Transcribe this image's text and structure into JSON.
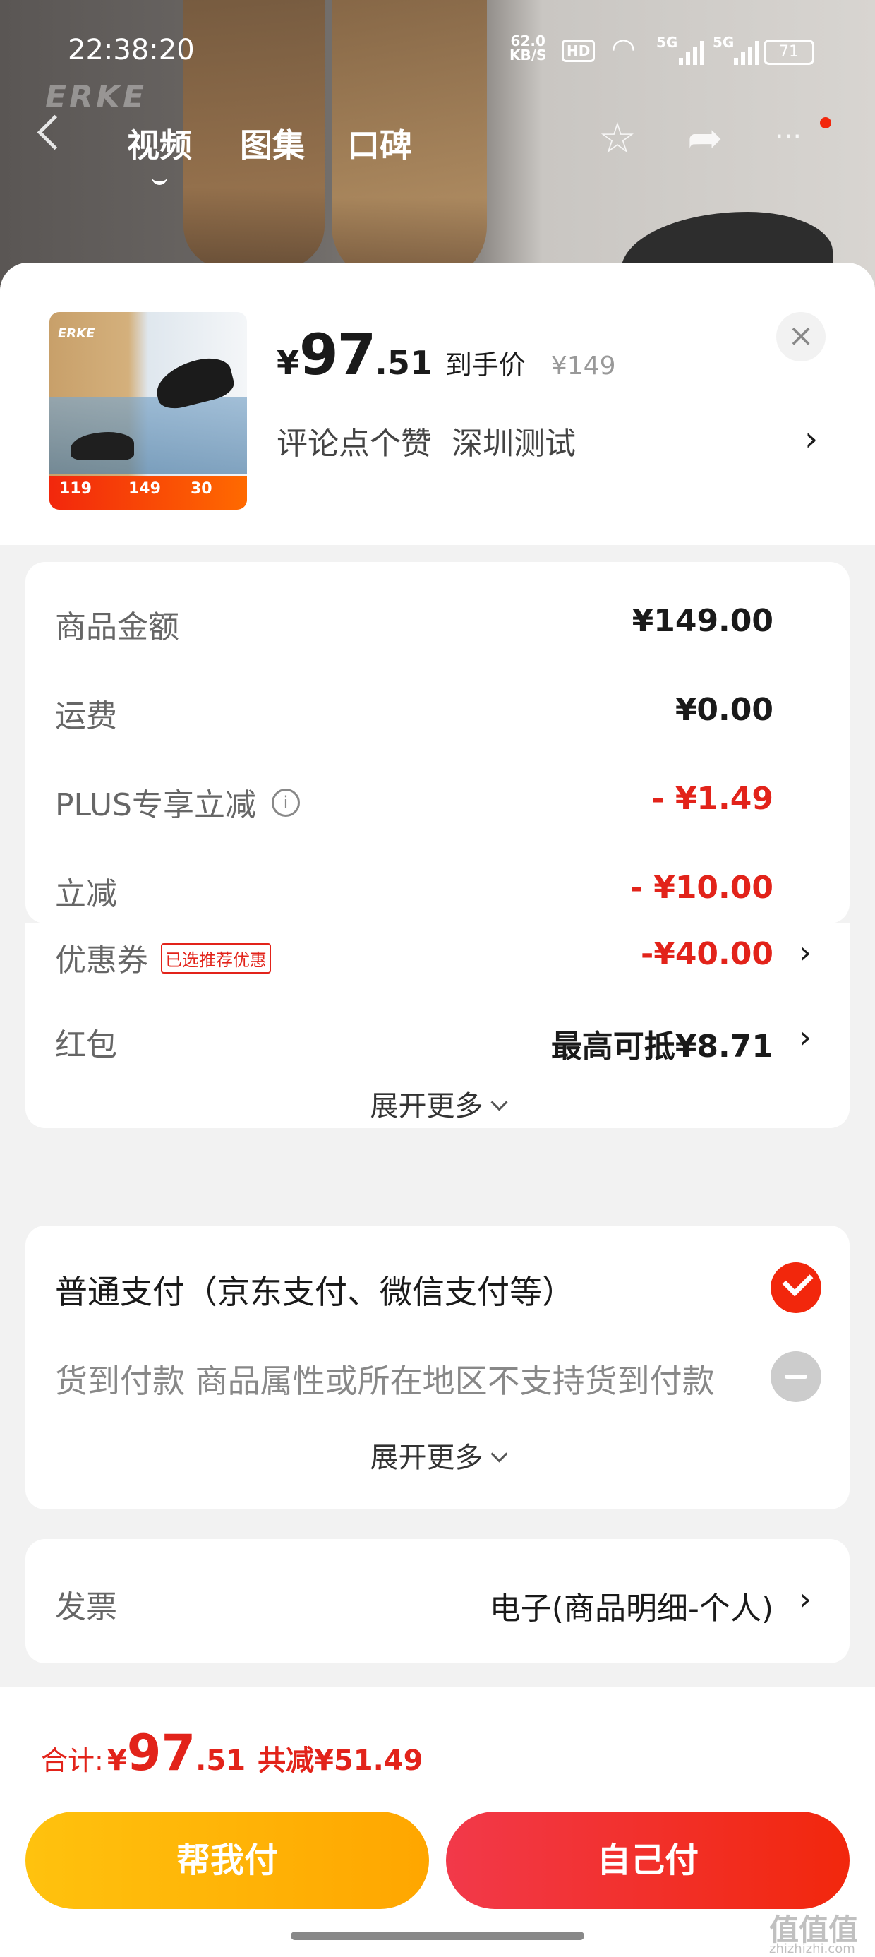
{
  "status_bar": {
    "time": "22:38:20",
    "net_speed": "62.0",
    "net_unit": "KB/S",
    "hd": "HD",
    "sig1": "5G",
    "sig2": "5G",
    "battery": "71"
  },
  "top_nav": {
    "tabs": [
      "视频",
      "图集",
      "口碑"
    ],
    "active_tab": 0,
    "watermark_logo": "ERKE"
  },
  "product": {
    "thumb_logo": "ERKE",
    "thumb_banner": [
      "119",
      "149",
      "30"
    ],
    "price_currency": "¥",
    "price_int": "97",
    "price_dec": ".51",
    "price_label": "到手价",
    "original_price": "¥149",
    "sub_items": [
      "评论点个赞",
      "深圳测试"
    ],
    "close_icon": "×"
  },
  "costs": {
    "rows": [
      {
        "label": "商品金额",
        "value": "¥149.00"
      },
      {
        "label": "运费",
        "value": "¥0.00"
      },
      {
        "label": "PLUS专享立减",
        "value": "- ¥1.49",
        "info": "i"
      },
      {
        "label": "立减",
        "value": "- ¥10.00"
      },
      {
        "label": "优惠券",
        "value": "-¥40.00",
        "tag": "已选推荐优惠"
      },
      {
        "label": "红包",
        "value": "最高可抵¥8.71"
      }
    ],
    "expand": "展开更多"
  },
  "payment": {
    "options": [
      {
        "label": "普通支付（京东支付、微信支付等）",
        "state": "selected"
      },
      {
        "label": "货到付款 商品属性或所在地区不支持货到付款",
        "state": "disabled"
      }
    ],
    "expand": "展开更多"
  },
  "invoice": {
    "label": "发票",
    "value": "电子(商品明细-个人)"
  },
  "footer": {
    "total_label": "合计:",
    "currency": "¥",
    "total_int": "97",
    "total_dec": ".51",
    "saved": "共减¥51.49",
    "help_pay": "帮我付",
    "self_pay": "自己付"
  },
  "watermark": {
    "brand": "值值值",
    "url": "zhizhizhi.com"
  },
  "colors": {
    "accent_red": "#e2231a",
    "accent_orange": "#ffa600"
  }
}
